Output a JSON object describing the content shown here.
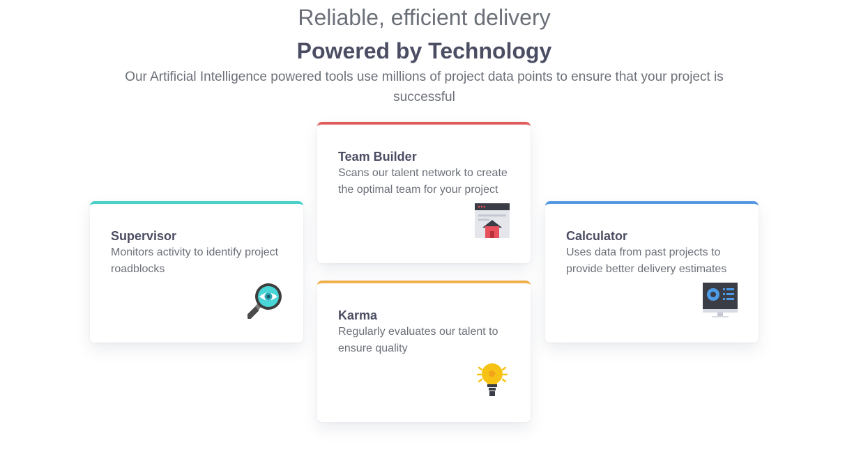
{
  "header": {
    "eyebrow": "Reliable, efficient delivery",
    "title": "Powered by Technology",
    "subtitle": "Our Artificial Intelligence powered tools use millions of project data points to ensure that your project is successful"
  },
  "cards": [
    {
      "id": "supervisor",
      "title": "Supervisor",
      "description": "Monitors activity to identify project roadblocks",
      "icon": "magnifier-eye-icon",
      "accent": "#48d0c9"
    },
    {
      "id": "team-builder",
      "title": "Team Builder",
      "description": "Scans our talent network to create the optimal team for your project",
      "icon": "browser-house-icon",
      "accent": "#e05c5c"
    },
    {
      "id": "karma",
      "title": "Karma",
      "description": "Regularly evaluates our talent to ensure quality",
      "icon": "lightbulb-icon",
      "accent": "#f0b04b"
    },
    {
      "id": "calculator",
      "title": "Calculator",
      "description": "Uses data from past projects to provide better delivery estimates",
      "icon": "monitor-dashboard-icon",
      "accent": "#5497e3"
    }
  ]
}
